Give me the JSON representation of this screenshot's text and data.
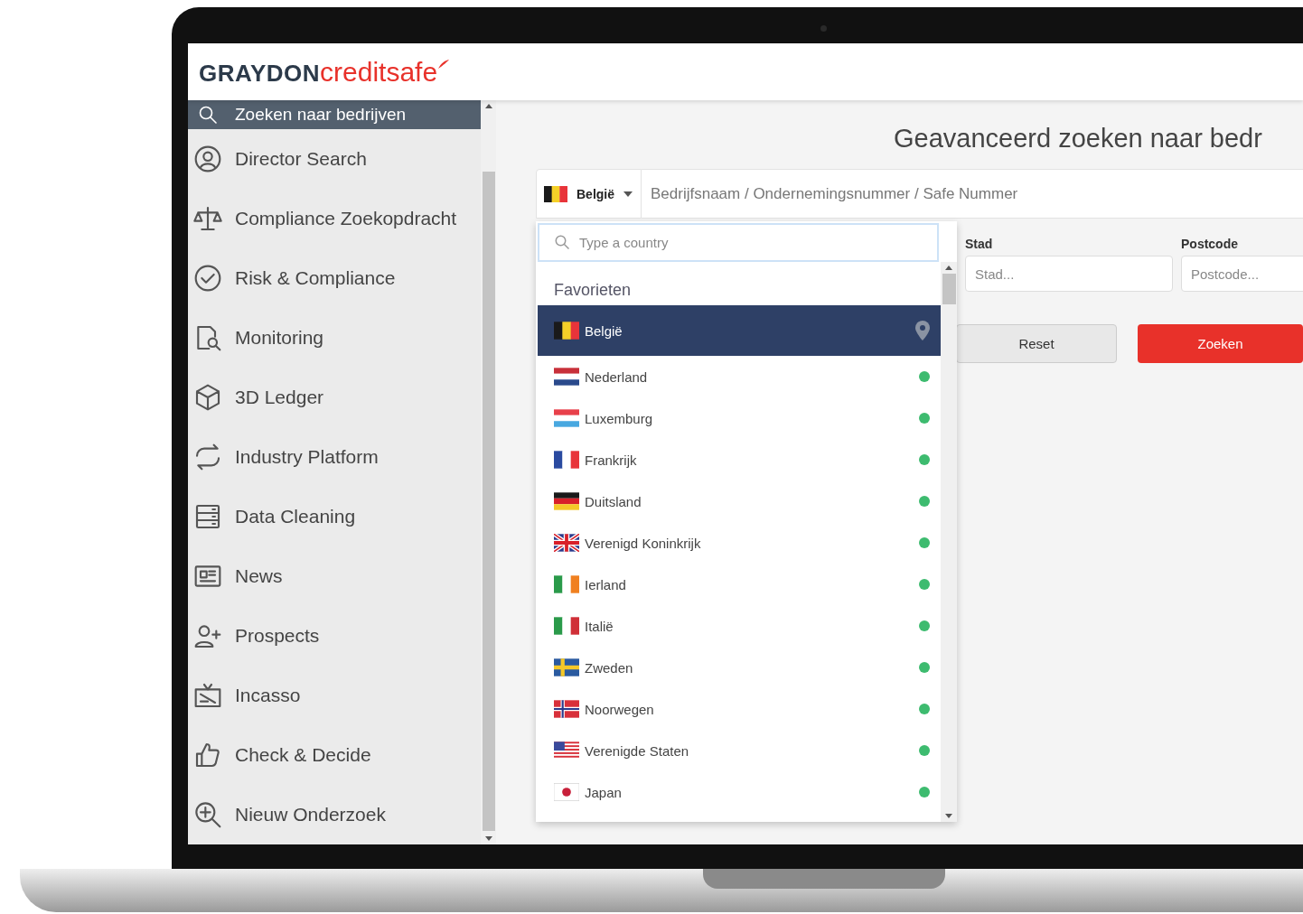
{
  "logo": {
    "primary": "GRAYDON",
    "secondary": "creditsafe"
  },
  "sidebar": {
    "items": [
      {
        "label": "Zoeken naar bedrijven",
        "selected": true
      },
      {
        "label": "Director Search",
        "selected": false
      },
      {
        "label": "Compliance Zoekopdracht",
        "selected": false
      },
      {
        "label": "Risk & Compliance",
        "selected": false
      },
      {
        "label": "Monitoring",
        "selected": false
      },
      {
        "label": "3D Ledger",
        "selected": false
      },
      {
        "label": "Industry Platform",
        "selected": false
      },
      {
        "label": "Data Cleaning",
        "selected": false
      },
      {
        "label": "News",
        "selected": false
      },
      {
        "label": "Prospects",
        "selected": false
      },
      {
        "label": "Incasso",
        "selected": false
      },
      {
        "label": "Check & Decide",
        "selected": false
      },
      {
        "label": "Nieuw Onderzoek",
        "selected": false
      }
    ]
  },
  "page_title": "Geavanceerd zoeken naar bedr",
  "search_bar": {
    "country": "België",
    "placeholder": "Bedrijfsnaam / Ondernemingsnummer / Safe Nummer"
  },
  "filters": [
    {
      "label": "Stad",
      "placeholder": "Stad..."
    },
    {
      "label": "Postcode",
      "placeholder": "Postcode..."
    }
  ],
  "buttons": [
    {
      "label": "Reset",
      "kind": "secondary"
    },
    {
      "label": "Zoeken",
      "kind": "primary"
    }
  ],
  "country_dropdown": {
    "search_placeholder": "Type a country",
    "group_heading": "Favorieten",
    "countries": [
      {
        "name": "België",
        "selected": true
      },
      {
        "name": "Nederland",
        "selected": false
      },
      {
        "name": "Luxemburg",
        "selected": false
      },
      {
        "name": "Frankrijk",
        "selected": false
      },
      {
        "name": "Duitsland",
        "selected": false
      },
      {
        "name": "Verenigd Koninkrijk",
        "selected": false
      },
      {
        "name": "Ierland",
        "selected": false
      },
      {
        "name": "Italië",
        "selected": false
      },
      {
        "name": "Zweden",
        "selected": false
      },
      {
        "name": "Noorwegen",
        "selected": false
      },
      {
        "name": "Verenigde Staten",
        "selected": false
      },
      {
        "name": "Japan",
        "selected": false
      }
    ]
  }
}
